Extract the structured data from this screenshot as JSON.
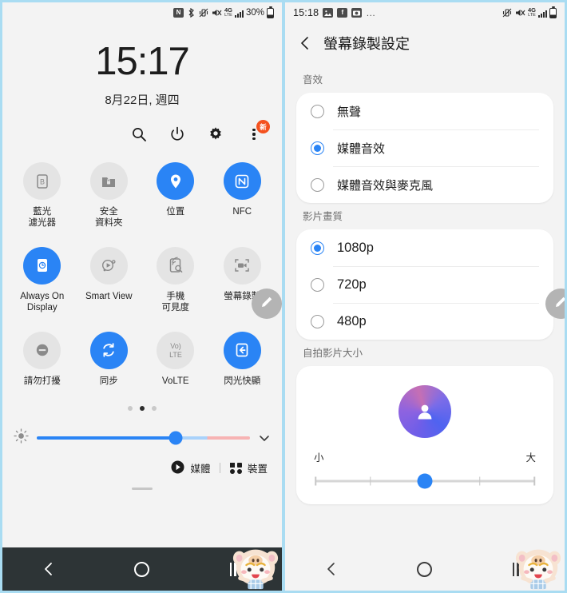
{
  "left_panel": {
    "statusbar": {
      "icons": [
        "nfc-icon",
        "bluetooth-icon",
        "vibrate-icon",
        "mute-icon",
        "4g-icon",
        "signal-icon"
      ],
      "network_label": "4G",
      "network_sub": "LTE",
      "battery_percent": "30%"
    },
    "clock": {
      "time": "15:17",
      "date": "8月22日, 週四"
    },
    "quick_actions": [
      {
        "name": "search-icon",
        "label": "搜尋"
      },
      {
        "name": "power-icon",
        "label": "電源"
      },
      {
        "name": "settings-gear-icon",
        "label": "設定"
      },
      {
        "name": "overflow-menu-icon",
        "label": "更多",
        "badge": "新"
      }
    ],
    "tiles": [
      {
        "label": "藍光\n濾光器",
        "label_line1": "藍光",
        "label_line2": "濾光器",
        "icon": "blue-light-filter-icon",
        "active": false
      },
      {
        "label": "安全\n資料夾",
        "label_line1": "安全",
        "label_line2": "資料夾",
        "icon": "secure-folder-icon",
        "active": false
      },
      {
        "label": "位置",
        "label_line1": "位置",
        "label_line2": "",
        "icon": "location-pin-icon",
        "active": true
      },
      {
        "label": "NFC",
        "label_line1": "NFC",
        "label_line2": "",
        "icon": "nfc-icon",
        "active": true
      },
      {
        "label": "Always On Display",
        "label_line1": "Always On",
        "label_line2": "Display",
        "icon": "always-on-display-icon",
        "active": true
      },
      {
        "label": "Smart View",
        "label_line1": "Smart View",
        "label_line2": "",
        "icon": "smart-view-icon",
        "active": false
      },
      {
        "label": "手機\n可見度",
        "label_line1": "手機",
        "label_line2": "可見度",
        "icon": "phone-visibility-icon",
        "active": false
      },
      {
        "label": "螢幕錄製",
        "label_line1": "螢幕錄製",
        "label_line2": "",
        "icon": "screen-recorder-icon",
        "active": false
      },
      {
        "label": "請勿打擾",
        "label_line1": "請勿打擾",
        "label_line2": "",
        "icon": "do-not-disturb-icon",
        "active": false
      },
      {
        "label": "同步",
        "label_line1": "同步",
        "label_line2": "",
        "icon": "sync-icon",
        "active": true
      },
      {
        "label": "VoLTE",
        "label_line1": "VoLTE",
        "label_line2": "",
        "icon": "volte-icon",
        "active": false
      },
      {
        "label": "閃光快顯",
        "label_line1": "閃光快顯",
        "label_line2": "",
        "icon": "flash-popup-icon",
        "active": true
      }
    ],
    "pager": {
      "pages": 3,
      "active_index": 1
    },
    "brightness": {
      "icon": "brightness-icon",
      "fill_percent": "65%",
      "expand_icon": "chevron-down-icon"
    },
    "bottom_bar": {
      "media_label": "媒體",
      "media_icon": "play-circle-icon",
      "devices_label": "裝置",
      "devices_icon": "grid-devices-icon"
    },
    "edit_fab": {
      "icon": "pencil-icon",
      "label": "編輯"
    },
    "navbar": {
      "back_icon": "back-chevron-icon",
      "home_icon": "home-circle-icon",
      "recents_icon": "recents-bars-icon"
    },
    "watermark": "pig-mascot"
  },
  "right_panel": {
    "statusbar": {
      "time": "15:18",
      "notif_icons": [
        "gallery-icon",
        "facebook-icon",
        "photo-app-icon"
      ],
      "more_dots": "…",
      "icons": [
        "vibrate-icon",
        "mute-icon",
        "4g-icon",
        "signal-icon",
        "battery-icon"
      ],
      "network_label": "4G",
      "network_sub": "LTE"
    },
    "header": {
      "back_icon": "back-chevron-icon",
      "title": "螢幕錄製設定"
    },
    "sections": [
      {
        "title": "音效",
        "options": [
          {
            "label": "無聲",
            "selected": false
          },
          {
            "label": "媒體音效",
            "selected": true
          },
          {
            "label": "媒體音效與麥克風",
            "selected": false
          }
        ]
      },
      {
        "title": "影片畫質",
        "options": [
          {
            "label": "1080p",
            "selected": true
          },
          {
            "label": "720p",
            "selected": false
          },
          {
            "label": "480p",
            "selected": false
          }
        ]
      }
    ],
    "selfie": {
      "title": "自拍影片大小",
      "avatar_icon": "person-avatar-icon",
      "min_label": "小",
      "max_label": "大",
      "slider_position": "50%"
    },
    "edit_fab": {
      "icon": "pencil-icon",
      "label": "編輯"
    },
    "navbar": {
      "back_icon": "back-chevron-icon",
      "home_icon": "home-circle-icon",
      "recents_icon": "recents-bars-icon"
    },
    "watermark": "pig-mascot"
  }
}
